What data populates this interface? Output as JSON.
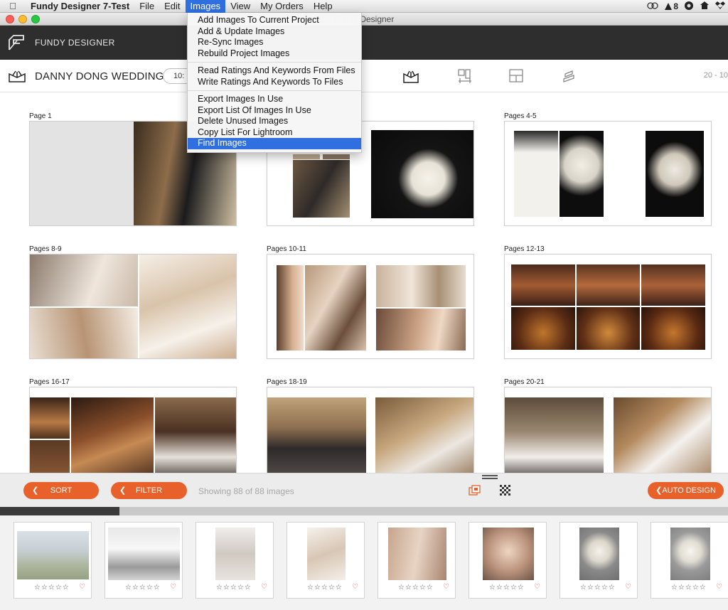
{
  "menubar": {
    "app_name": "Fundy Designer 7-Test",
    "items": [
      "File",
      "Edit",
      "Images",
      "View",
      "My Orders",
      "Help"
    ],
    "active_item": "Images",
    "status_text": "8"
  },
  "window": {
    "title": "Fundy Designer"
  },
  "app_header": {
    "brand": "FUNDY DESIGNER"
  },
  "project": {
    "name": "DANNY DONG WEDDING",
    "pill_text": "10:",
    "page_count": "20 - 10"
  },
  "images_menu": {
    "groups": [
      [
        "Add Images To Current Project",
        "Add & Update Images",
        "Re-Sync Images",
        "Rebuild Project Images"
      ],
      [
        "Read Ratings And Keywords From Files",
        "Write Ratings And Keywords To Files"
      ],
      [
        "Export Images In Use",
        "Export List Of Images In Use",
        "Delete Unused Images",
        "Copy List For Lightroom",
        "Find Images"
      ]
    ],
    "highlighted": "Find Images"
  },
  "spreads": [
    {
      "label": "Page 1"
    },
    {
      "label": ""
    },
    {
      "label": "Pages 4-5"
    },
    {
      "label": "Pages 8-9"
    },
    {
      "label": "Pages 10-11"
    },
    {
      "label": "Pages 12-13"
    },
    {
      "label": "Pages 16-17"
    },
    {
      "label": "Pages 18-19"
    },
    {
      "label": "Pages 20-21"
    }
  ],
  "controls": {
    "sort_label": "SORT",
    "filter_label": "FILTER",
    "showing_text": "Showing 88 of 88 images",
    "auto_design_label": "AUTO DESIGN"
  },
  "strip_progress": 0.16,
  "filmstrip": {
    "count": 8,
    "rating_text": "☆☆☆☆☆",
    "heart": "♡"
  },
  "colors": {
    "accent_orange": "#e8612a",
    "menu_highlight": "#2f6fe0",
    "header_dark": "#2e2e2e"
  }
}
